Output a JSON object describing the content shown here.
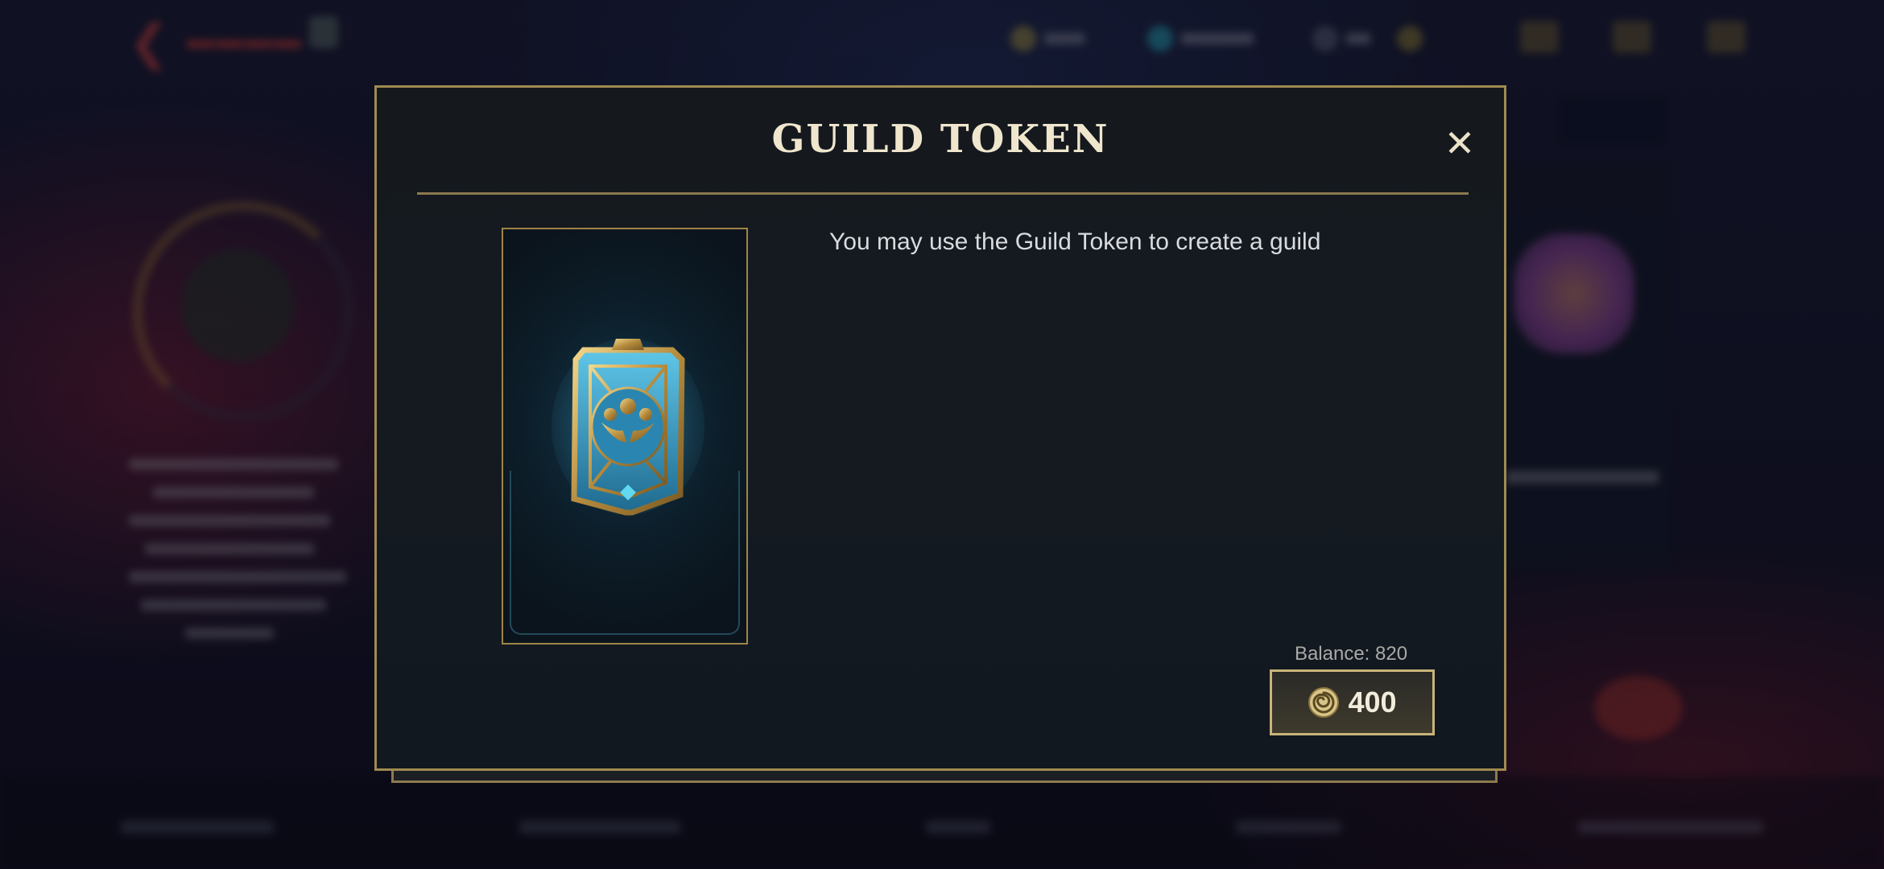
{
  "dialog": {
    "title": "GUILD TOKEN",
    "close_symbol": "✕",
    "description": "You may use the Guild Token to create a guild",
    "item_icon": "guild-token-icon",
    "balance_label": "Balance: 820",
    "price": "400",
    "currency_icon": "spiral-coin-icon"
  },
  "colors": {
    "gold_border": "#a08a52",
    "title_text": "#efe6cd",
    "dialog_bg": "#15191e",
    "button_border": "#c8b47a"
  }
}
